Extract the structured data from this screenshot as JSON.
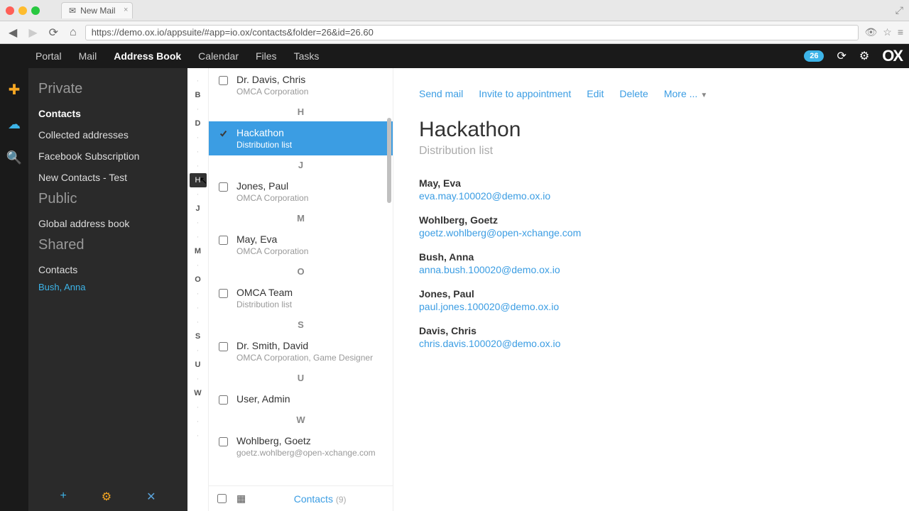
{
  "window": {
    "tab_title": "New Mail",
    "url": "https://demo.ox.io/appsuite/#app=io.ox/contacts&folder=26&id=26.60"
  },
  "topnav": {
    "items": [
      "Portal",
      "Mail",
      "Address Book",
      "Calendar",
      "Files",
      "Tasks"
    ],
    "active_index": 2,
    "badge": "26"
  },
  "foldertree": {
    "sections": [
      {
        "title": "Private",
        "items": [
          {
            "label": "Contacts",
            "active": true
          },
          {
            "label": "Collected addresses"
          },
          {
            "label": "Facebook Subscription"
          },
          {
            "label": "New Contacts - Test"
          }
        ]
      },
      {
        "title": "Public",
        "items": [
          {
            "label": "Global address book"
          }
        ]
      },
      {
        "title": "Shared",
        "items": [
          {
            "label": "Contacts",
            "sub": "Bush, Anna"
          }
        ]
      }
    ]
  },
  "alpha": {
    "letters": [
      "·",
      "B",
      "·",
      "D",
      "·",
      "·",
      "·",
      "H",
      "·",
      "J",
      "·",
      "·",
      "M",
      "·",
      "O",
      "·",
      "·",
      "·",
      "S",
      "·",
      "U",
      "·",
      "W",
      "·",
      "·",
      "·"
    ],
    "bold": [
      "B",
      "D",
      "H",
      "J",
      "M",
      "O",
      "S",
      "U",
      "W"
    ],
    "highlight": "H"
  },
  "list": {
    "rows": [
      {
        "type": "row",
        "title": "Dr. Davis, Chris",
        "sub": "OMCA Corporation"
      },
      {
        "type": "divider",
        "letter": "H"
      },
      {
        "type": "row",
        "title": "Hackathon",
        "sub": "Distribution list",
        "selected": true,
        "checked": true
      },
      {
        "type": "divider",
        "letter": "J"
      },
      {
        "type": "row",
        "title": "Jones, Paul",
        "sub": "OMCA Corporation"
      },
      {
        "type": "divider",
        "letter": "M"
      },
      {
        "type": "row",
        "title": "May, Eva",
        "sub": "OMCA Corporation"
      },
      {
        "type": "divider",
        "letter": "O"
      },
      {
        "type": "row",
        "title": "OMCA Team",
        "sub": "Distribution list"
      },
      {
        "type": "divider",
        "letter": "S"
      },
      {
        "type": "row",
        "title": "Dr. Smith, David",
        "sub": "OMCA Corporation, Game Designer"
      },
      {
        "type": "divider",
        "letter": "U"
      },
      {
        "type": "row",
        "title": "User, Admin",
        "sub": ""
      },
      {
        "type": "divider",
        "letter": "W"
      },
      {
        "type": "row",
        "title": "Wohlberg, Goetz",
        "sub": "goetz.wohlberg@open-xchange.com"
      }
    ],
    "footer_label": "Contacts",
    "footer_count": "(9)"
  },
  "detail": {
    "actions": [
      "Send mail",
      "Invite to appointment",
      "Edit",
      "Delete",
      "More ..."
    ],
    "title": "Hackathon",
    "subtitle": "Distribution list",
    "members": [
      {
        "name": "May, Eva",
        "email": "eva.may.100020@demo.ox.io"
      },
      {
        "name": "Wohlberg, Goetz",
        "email": "goetz.wohlberg@open-xchange.com"
      },
      {
        "name": "Bush, Anna",
        "email": "anna.bush.100020@demo.ox.io"
      },
      {
        "name": "Jones, Paul",
        "email": "paul.jones.100020@demo.ox.io"
      },
      {
        "name": "Davis, Chris",
        "email": "chris.davis.100020@demo.ox.io"
      }
    ]
  }
}
